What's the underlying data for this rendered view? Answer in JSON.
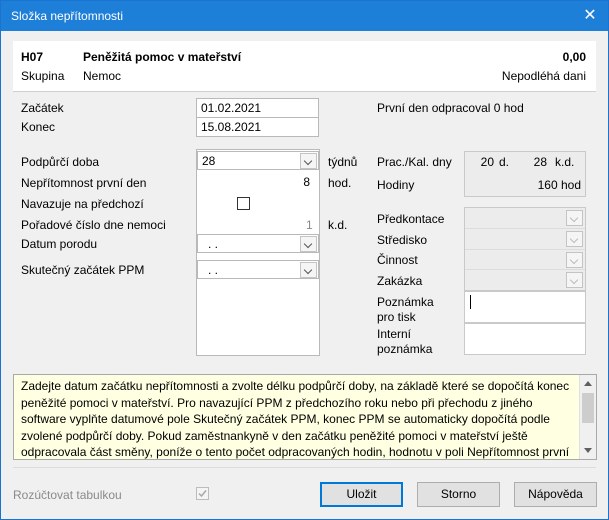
{
  "window": {
    "title": "Složka nepřítomnosti",
    "close_glyph": "✕"
  },
  "header": {
    "code": "H07",
    "name": "Peněžitá pomoc v mateřství",
    "amount": "0,00",
    "group_label": "Skupina",
    "group_value": "Nemoc",
    "tax_status": "Nepodléhá dani"
  },
  "dates": {
    "start_label": "Začátek",
    "start_value": "01.02.2021",
    "end_label": "Konec",
    "end_value": "15.08.2021",
    "first_day_note": "První den odpracoval 0 hod"
  },
  "fields": {
    "support_period_label": "Podpůrčí doba",
    "support_period_value": "28",
    "support_period_unit": "týdnů",
    "absence_first_day_label": "Nepřítomnost první den",
    "absence_first_day_value": "8",
    "absence_first_day_unit": "hod.",
    "follows_previous_label": "Navazuje na předchozí",
    "sick_day_order_label": "Pořadové číslo dne nemoci",
    "sick_day_order_value": "1",
    "sick_day_order_unit": "k.d.",
    "birth_date_label": "Datum porodu",
    "birth_date_value": ". .",
    "ppm_start_label": "Skutečný začátek PPM",
    "ppm_start_value": ". ."
  },
  "stats": {
    "work_days_label": "Prac./Kal. dny",
    "work_days_value": "20",
    "work_days_unit": "d.",
    "cal_days_value": "28",
    "cal_days_unit": "k.d.",
    "hours_label": "Hodiny",
    "hours_value": "160 hod"
  },
  "accounting": {
    "predkontace_label": "Předkontace",
    "stredisko_label": "Středisko",
    "cinnost_label": "Činnost",
    "zakazka_label": "Zakázka",
    "print_note_label_1": "Poznámka",
    "print_note_label_2": "pro tisk",
    "internal_note_label_1": "Interní",
    "internal_note_label_2": "poznámka"
  },
  "info_text": "Zadejte datum začátku nepřítomnosti a zvolte délku podpůrčí doby, na základě které se dopočítá konec peněžité pomoci v mateřství. Pro navazující PPM z předchozího roku nebo při přechodu z jiného software vyplňte datumové pole Skutečný začátek PPM, konec PPM se automaticky dopočítá podle zvolené podpůrčí doby. Pokud zaměstnankyně v den začátku peněžité pomoci v mateřství ještě odpracovala část směny, poníže o tento počet odpracovaných hodin, hodnotu v poli Nepřítomnost první den. Do pole",
  "footer": {
    "allocate_label": "Rozúčtovat tabulkou",
    "ok_label": "Uložit",
    "cancel_label": "Storno",
    "help_label": "Nápověda"
  }
}
